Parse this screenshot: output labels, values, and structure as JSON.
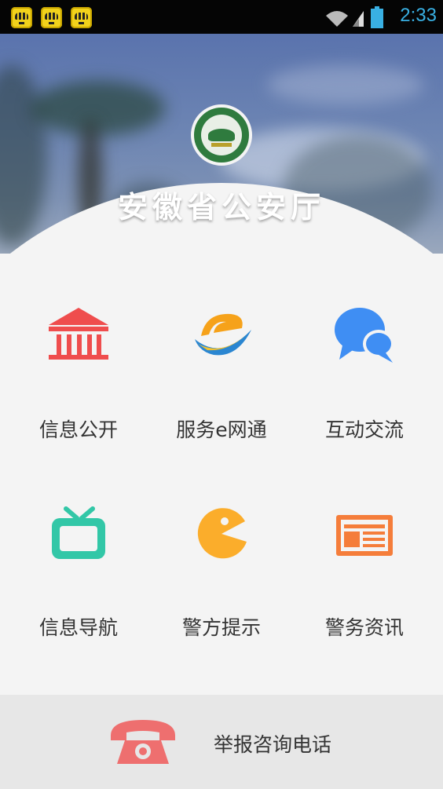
{
  "status_bar": {
    "time": "2:33",
    "notification_icons": [
      "bee-app-icon",
      "bee-app-icon",
      "bee-app-icon"
    ]
  },
  "header": {
    "title": "安徽省公安厅",
    "emblem": "police-emblem"
  },
  "grid": [
    {
      "label": "信息公开",
      "icon": "bank-building-icon",
      "color": "#ef4d4d"
    },
    {
      "label": "服务e网通",
      "icon": "e-logo-icon",
      "color": "#3c8ad6"
    },
    {
      "label": "互动交流",
      "icon": "chat-bubbles-icon",
      "color": "#3f8ef3"
    },
    {
      "label": "信息导航",
      "icon": "tv-icon",
      "color": "#32c7a7"
    },
    {
      "label": "警方提示",
      "icon": "pacman-icon",
      "color": "#fbad2b"
    },
    {
      "label": "警务资讯",
      "icon": "newspaper-icon",
      "color": "#f57d3a"
    }
  ],
  "hotline": {
    "label": "举报咨询电话",
    "icon": "phone-icon",
    "color": "#ee6f6f"
  },
  "colors": {
    "clock": "#39b0e3",
    "background": "#f4f4f4",
    "hotline_bg": "#e7e7e7"
  }
}
